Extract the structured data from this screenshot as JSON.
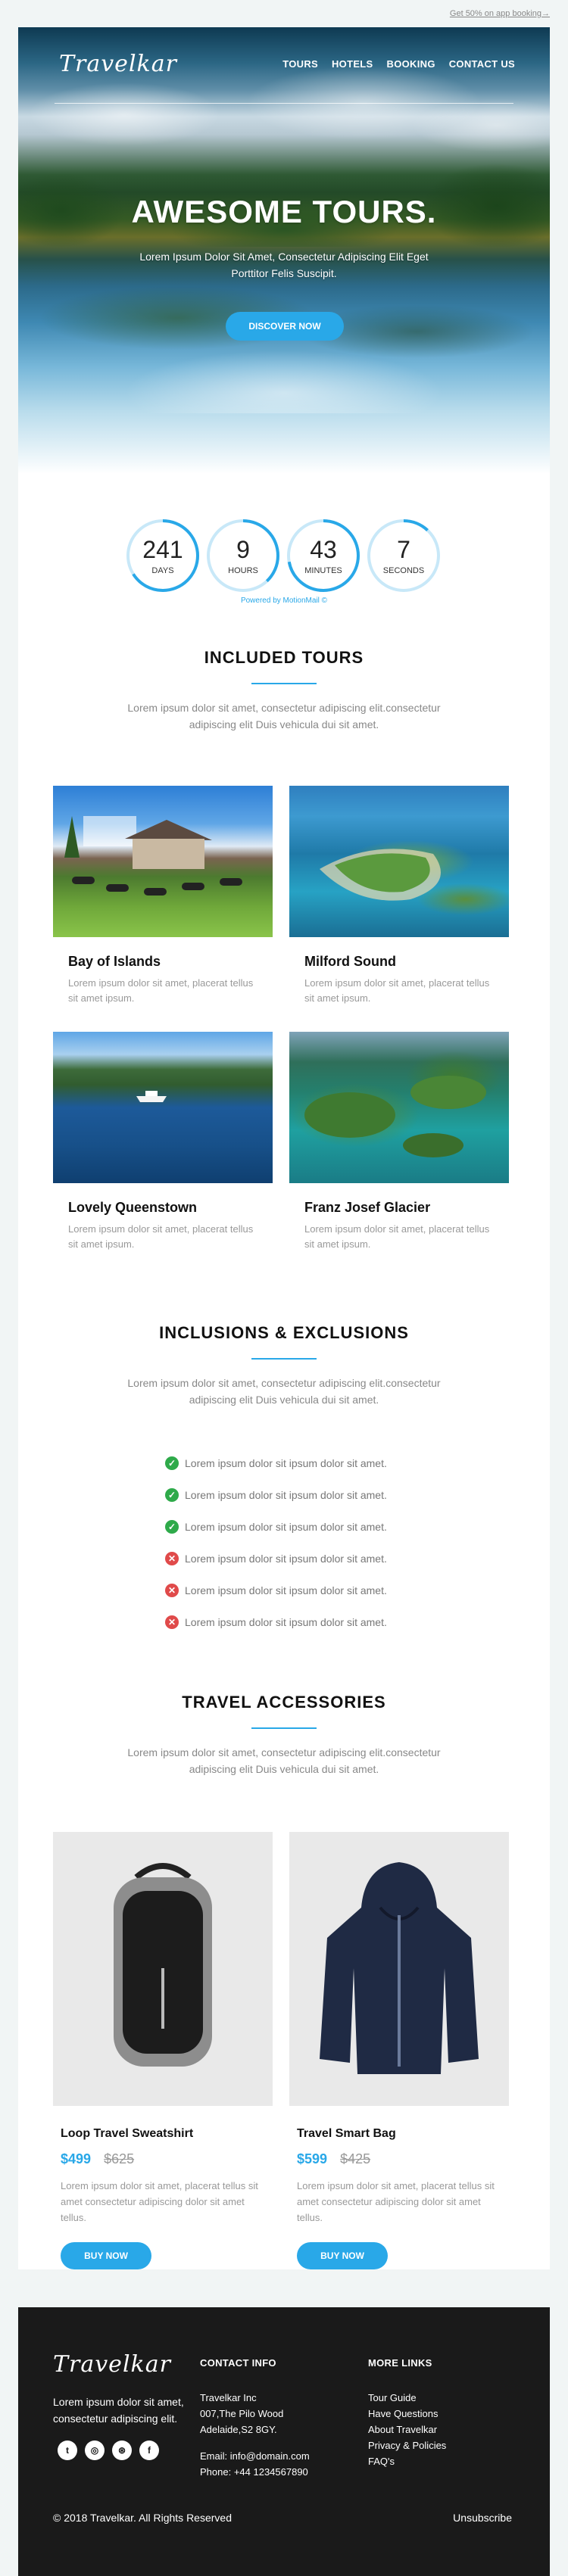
{
  "topbar": {
    "link": "Get 50% on app booking→"
  },
  "brand": {
    "logo": "Travelkar"
  },
  "nav": [
    "TOURS",
    "HOTELS",
    "BOOKING",
    "CONTACT US"
  ],
  "hero": {
    "title": "AWESOME TOURS.",
    "subtitle": "Lorem Ipsum Dolor Sit Amet, Consectetur Adipiscing Elit Eget Porttitor Felis Suscipit.",
    "button": "DISCOVER NOW"
  },
  "countdown": {
    "items": [
      {
        "value": "241",
        "label": "DAYS",
        "progress": 0.66
      },
      {
        "value": "9",
        "label": "HOURS",
        "progress": 0.38
      },
      {
        "value": "43",
        "label": "MINUTES",
        "progress": 0.72
      },
      {
        "value": "7",
        "label": "SECONDS",
        "progress": 0.12
      }
    ],
    "powered": "Powered by MotionMail ©"
  },
  "tours_section": {
    "title": "INCLUDED TOURS",
    "intro": "Lorem ipsum dolor sit amet, consectetur adipiscing elit.consectetur adipiscing elit Duis vehicula dui sit amet.",
    "tours": [
      {
        "name": "Bay of Islands",
        "desc": "Lorem ipsum dolor sit amet, placerat tellus sit amet ipsum."
      },
      {
        "name": "Milford Sound",
        "desc": "Lorem ipsum dolor sit amet, placerat tellus sit amet ipsum."
      },
      {
        "name": "Lovely Queenstown",
        "desc": "Lorem ipsum dolor sit amet, placerat tellus sit amet ipsum."
      },
      {
        "name": "Franz Josef Glacier",
        "desc": "Lorem ipsum dolor sit amet, placerat tellus sit amet ipsum."
      }
    ]
  },
  "inclusions_section": {
    "title": "INCLUSIONS & EXCLUSIONS",
    "intro": "Lorem ipsum dolor sit amet, consectetur adipiscing elit.consectetur adipiscing elit Duis vehicula dui sit amet.",
    "items": [
      {
        "text": "Lorem ipsum dolor sit ipsum dolor sit amet.",
        "status": "included"
      },
      {
        "text": "Lorem ipsum dolor sit ipsum dolor sit amet.",
        "status": "included"
      },
      {
        "text": "Lorem ipsum dolor sit ipsum dolor sit amet.",
        "status": "included"
      },
      {
        "text": "Lorem ipsum dolor sit ipsum dolor sit amet.",
        "status": "excluded"
      },
      {
        "text": "Lorem ipsum dolor sit ipsum dolor sit amet.",
        "status": "excluded"
      },
      {
        "text": "Lorem ipsum dolor sit ipsum dolor sit amet.",
        "status": "excluded"
      }
    ]
  },
  "accessories_section": {
    "title": "TRAVEL ACCESSORIES",
    "intro": "Lorem ipsum dolor sit amet, consectetur adipiscing elit.consectetur adipiscing elit Duis vehicula dui sit amet.",
    "products": [
      {
        "name": "Loop Travel Sweatshirt",
        "price": "$499",
        "old_price": "$625",
        "desc": "Lorem ipsum dolor sit amet, placerat tellus sit amet consectetur adipiscing dolor sit amet tellus.",
        "button": "BUY NOW"
      },
      {
        "name": "Travel Smart Bag",
        "price": "$599",
        "old_price": "$425",
        "desc": "Lorem ipsum dolor sit amet, placerat tellus sit amet consectetur adipiscing dolor sit amet tellus.",
        "button": "BUY NOW"
      }
    ]
  },
  "footer": {
    "logo": "Travelkar",
    "tagline": "Lorem ipsum dolor sit amet, consectetur adipiscing elit.",
    "social": [
      "twitter-icon",
      "instagram-icon",
      "dribbble-icon",
      "facebook-icon"
    ],
    "contact": {
      "title": "CONTACT INFO",
      "company": "Travelkar Inc",
      "address1": "007,The Pilo Wood",
      "address2": "Adelaide,S2 8GY.",
      "email": "Email: info@domain.com",
      "phone": "Phone: +44 1234567890"
    },
    "links": {
      "title": "MORE LINKS",
      "items": [
        "Tour Guide",
        "Have Questions",
        "About Travelkar",
        "Privacy & Policies",
        "FAQ's"
      ]
    },
    "copyright": "© 2018 Travelkar. All Rights Reserved",
    "unsubscribe": "Unsubscribe"
  },
  "colors": {
    "accent": "#29a8e8",
    "footer_bg": "#1a1a1a",
    "ok": "#2eaa4a",
    "no": "#e04a4a"
  }
}
